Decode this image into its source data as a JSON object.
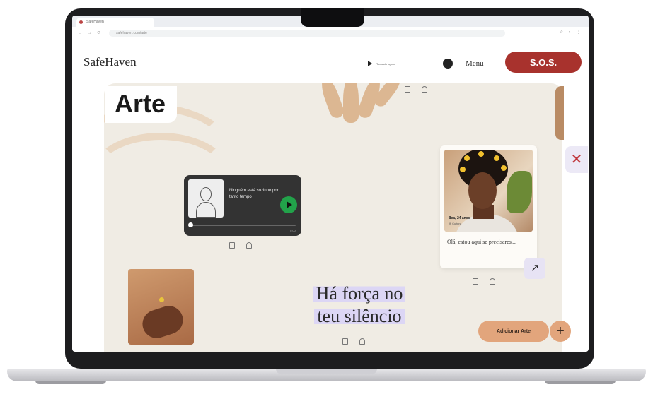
{
  "browser": {
    "tab_title": "SafeHaven",
    "url": "safehaven.com/arte",
    "nav": "← → ⟳",
    "icons": "☆ ◐ ⋮"
  },
  "header": {
    "brand": "SafeHaven",
    "player_text": "Tocando agora",
    "menu_label": "Menu",
    "sos_label": "S.O.S."
  },
  "page": {
    "title": "Arte",
    "close_symbol": "✕"
  },
  "music_card": {
    "title": "Ninguém está sozinho por tanto tempo",
    "artist": "",
    "time": "0:00",
    "progress": 0.02
  },
  "portrait_card": {
    "caption_name": "Bea, 24 anos",
    "caption_sub": "@ Cultura",
    "text": "Olá, estou aqui se precisares...",
    "arrow_symbol": "↗"
  },
  "quote": {
    "line1": "Há força no",
    "line2": "teu silêncio"
  },
  "actions": {
    "add_art_label": "Adicionar Arte",
    "plus_symbol": "+"
  },
  "colors": {
    "sos": "#a8322d",
    "canvas": "#f0ece4",
    "accent_peach": "#e2a57c",
    "highlight_lavender": "#dcd6f5",
    "play_green": "#22a24a"
  }
}
